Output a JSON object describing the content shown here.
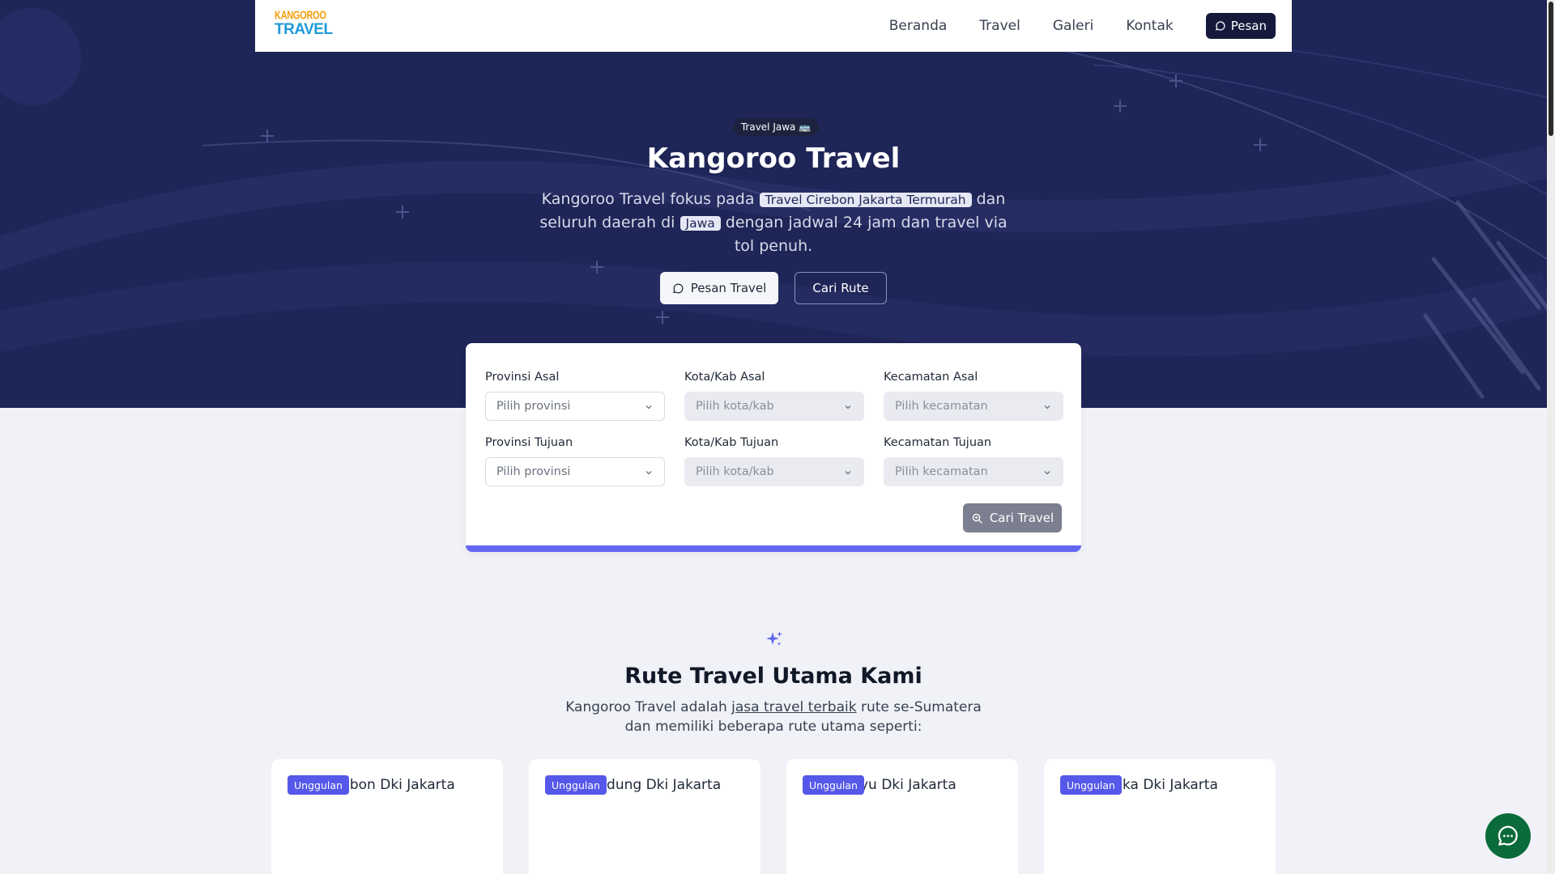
{
  "brand": {
    "logo_top": "KANGOROO",
    "logo_bottom": "TRAVEL"
  },
  "nav": {
    "items": [
      "Beranda",
      "Travel",
      "Galeri",
      "Kontak"
    ],
    "cta_label": "Pesan"
  },
  "hero": {
    "badge": "Travel Jawa 🚌",
    "title": "Kangoroo Travel",
    "desc_1": "Kangoroo Travel fokus pada",
    "desc_hl_1": "Travel Cirebon Jakarta Termurah",
    "desc_2": "dan seluruh daerah di",
    "desc_hl_2": "Jawa",
    "desc_3": "dengan jadwal 24 jam dan travel via tol penuh.",
    "btn_primary": "Pesan Travel",
    "btn_secondary": "Cari Rute"
  },
  "search": {
    "fields": [
      {
        "label": "Provinsi Asal",
        "placeholder": "Pilih provinsi",
        "disabled": false
      },
      {
        "label": "Kota/Kab Asal",
        "placeholder": "Pilih kota/kab",
        "disabled": true
      },
      {
        "label": "Kecamatan Asal",
        "placeholder": "Pilih kecamatan",
        "disabled": true
      },
      {
        "label": "Provinsi Tujuan",
        "placeholder": "Pilih provinsi",
        "disabled": false
      },
      {
        "label": "Kota/Kab Tujuan",
        "placeholder": "Pilih kota/kab",
        "disabled": true
      },
      {
        "label": "Kecamatan Tujuan",
        "placeholder": "Pilih kecamatan",
        "disabled": true
      }
    ],
    "submit_label": "Cari Travel"
  },
  "routes": {
    "title": "Rute Travel Utama Kami",
    "desc_1": "Kangoroo Travel adalah",
    "desc_link": "jasa travel terbaik",
    "desc_2": "rute se-Sumatera",
    "desc_3": "dan memiliki beberapa rute utama seperti:",
    "cards": [
      {
        "tag": "Unggulan",
        "title": "Kota Cirebon Dki Jakarta"
      },
      {
        "tag": "Unggulan",
        "title": "Kota Bandung Dki Jakarta"
      },
      {
        "tag": "Unggulan",
        "title": "Indramayu Dki Jakarta"
      },
      {
        "tag": "Unggulan",
        "title": "Majalengka Dki Jakarta"
      }
    ]
  },
  "colors": {
    "hero_bg": "#1e2557",
    "accent": "#6366f1",
    "whatsapp": "#0b6b3a",
    "nav_cta": "#151a3d"
  }
}
